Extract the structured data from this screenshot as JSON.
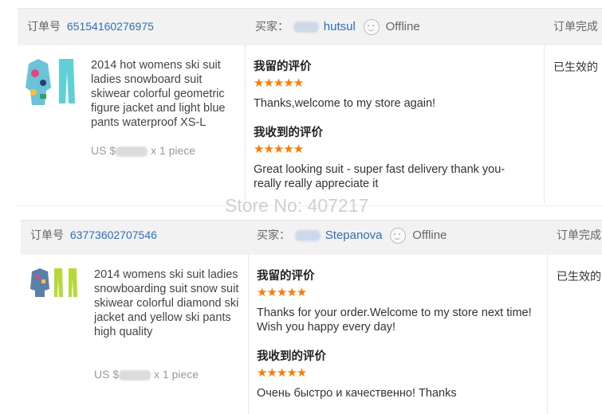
{
  "orders": [
    {
      "order_label": "订单号",
      "order_id": "65154160276975",
      "buyer_label": "买家：",
      "buyer_name": "hutsul",
      "status_text": "Offline",
      "right_header": "订单完成",
      "product_title": "2014 hot womens ski suit ladies snowboard suit skiwear colorful geometric figure jacket and light blue pants waterproof XS-L",
      "price_prefix": "US $",
      "price_suffix": "x 1 piece",
      "my_review_label": "我留的评价",
      "my_review_stars": 5,
      "my_review_text": "Thanks,welcome to my store again!",
      "received_review_label": "我收到的评价",
      "received_review_stars": 5,
      "received_review_text": "Great looking suit - super fast delivery thank you- really really appreciate it",
      "right_status": "已生效的"
    },
    {
      "order_label": "订单号",
      "order_id": "63773602707546",
      "buyer_label": "买家：",
      "buyer_name": "Stepanova",
      "status_text": "Offline",
      "right_header": "订单完成",
      "product_title": "2014 womens ski suit ladies snowboarding suit snow suit skiwear colorful diamond ski jacket and yellow ski pants high quality",
      "price_prefix": "US $",
      "price_suffix": "x 1 piece",
      "my_review_label": "我留的评价",
      "my_review_stars": 5,
      "my_review_text": "Thanks for your order.Welcome to my store next time! Wish you happy every day!",
      "received_review_label": "我收到的评价",
      "received_review_stars": 5,
      "received_review_text": "Очень быстро и качественно! Thanks",
      "right_status": "已生效的"
    }
  ],
  "watermark": "Store No: 407217",
  "colors": {
    "link": "#2f6fb5",
    "star": "#ff7a00",
    "header_bg": "#f2f2f2"
  }
}
